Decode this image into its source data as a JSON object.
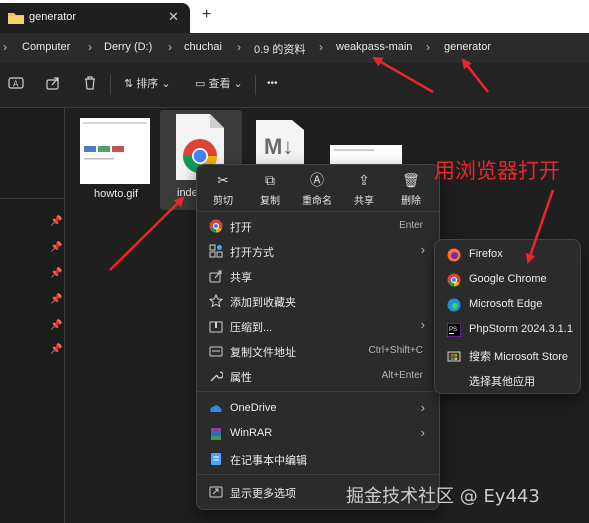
{
  "tab": {
    "title": "generator",
    "close": "✕",
    "new": "+"
  },
  "breadcrumb": {
    "lead": "›",
    "items": [
      "Computer",
      "Derry (D:)",
      "chuchai",
      "0.9 的资料",
      "weakpass-main",
      "generator"
    ],
    "sep": "›"
  },
  "toolbar": {
    "sort_label": "排序",
    "view_label": "查看",
    "more": "•••",
    "chevron": "⌄"
  },
  "files": [
    {
      "name": "howto.gif"
    },
    {
      "name": "inde"
    }
  ],
  "context_menu": {
    "quick_actions": [
      {
        "label": "剪切",
        "icon": "cut-icon",
        "glyph": "✂"
      },
      {
        "label": "复制",
        "icon": "copy-icon",
        "glyph": "⧉"
      },
      {
        "label": "重命名",
        "icon": "rename-icon",
        "glyph": "Ⓐ"
      },
      {
        "label": "共享",
        "icon": "share-icon",
        "glyph": "⇪"
      },
      {
        "label": "删除",
        "icon": "delete-icon",
        "glyph": "🗑"
      }
    ],
    "items": [
      {
        "label": "打开",
        "shortcut": "Enter"
      },
      {
        "label": "打开方式",
        "arrow": "›"
      },
      {
        "label": "共享"
      },
      {
        "label": "添加到收藏夹"
      },
      {
        "label": "压缩到...",
        "arrow": "›"
      },
      {
        "label": "复制文件地址",
        "shortcut": "Ctrl+Shift+C"
      },
      {
        "label": "属性",
        "shortcut": "Alt+Enter"
      },
      {
        "label": "OneDrive",
        "arrow": "›"
      },
      {
        "label": "WinRAR",
        "arrow": "›"
      },
      {
        "label": "在记事本中编辑"
      },
      {
        "label": "显示更多选项"
      }
    ]
  },
  "submenu": {
    "items": [
      {
        "label": "Firefox"
      },
      {
        "label": "Google Chrome"
      },
      {
        "label": "Microsoft Edge"
      },
      {
        "label": "PhpStorm 2024.3.1.1"
      },
      {
        "label": "搜索 Microsoft Store"
      },
      {
        "label": "选择其他应用"
      }
    ]
  },
  "annotation": "用浏览器打开",
  "watermark": "掘金技术社区 @ Ey443",
  "colors": {
    "arrow": "#e8262c",
    "accent": "#4aa3ff",
    "background": "#1f1f1f"
  }
}
